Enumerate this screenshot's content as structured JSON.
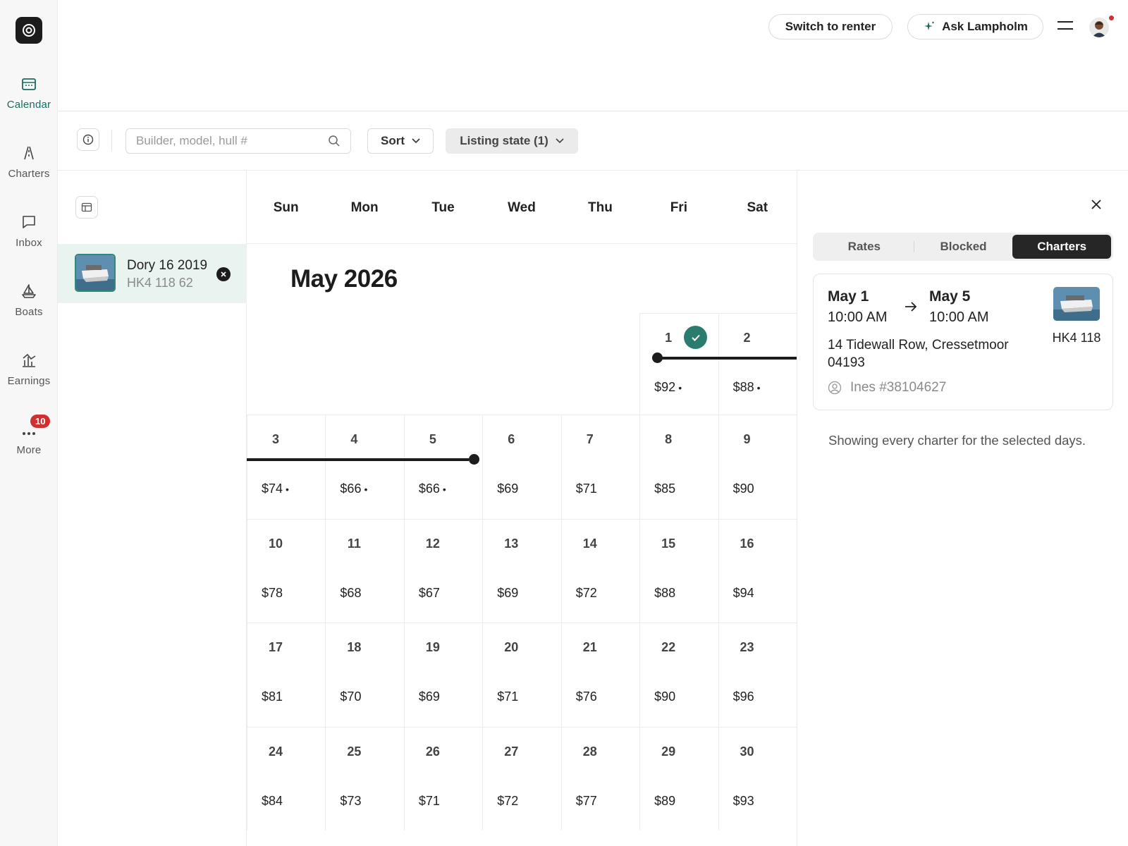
{
  "nav": {
    "items": [
      {
        "label": "Calendar",
        "icon": "calendar-icon",
        "active": true
      },
      {
        "label": "Charters",
        "icon": "route-icon"
      },
      {
        "label": "Inbox",
        "icon": "message-icon"
      },
      {
        "label": "Boats",
        "icon": "sailboat-icon"
      },
      {
        "label": "Earnings",
        "icon": "chart-icon"
      },
      {
        "label": "More",
        "icon": "more-dots-icon",
        "badge": "10"
      }
    ],
    "accent": "#1a6b5e",
    "badge_color": "#d0302f"
  },
  "header": {
    "switch_label": "Switch to renter",
    "ask_label": "Ask Lampholm",
    "ask_icon": "sparkle-icon",
    "menu_icon": "hamburger-icon"
  },
  "toolbar": {
    "search_placeholder": "Builder, model, hull #",
    "search_value": "",
    "sort_label": "Sort",
    "listing_state_label": "Listing state (1)"
  },
  "listing": {
    "name": "Dory 16 2019",
    "hull": "HK4 118 62"
  },
  "calendar": {
    "days_of_week": [
      "Sun",
      "Mon",
      "Tue",
      "Wed",
      "Thu",
      "Fri",
      "Sat"
    ],
    "month_title": "May 2026",
    "first_week": [
      {
        "day": "1",
        "price": "$92",
        "dot": "•",
        "checked": true
      },
      {
        "day": "2",
        "price": "$88",
        "dot": "•"
      }
    ],
    "weeks": [
      [
        {
          "day": "3",
          "price": "$74",
          "dot": "•"
        },
        {
          "day": "4",
          "price": "$66",
          "dot": "•"
        },
        {
          "day": "5",
          "price": "$66",
          "dot": "•"
        },
        {
          "day": "6",
          "price": "$69"
        },
        {
          "day": "7",
          "price": "$71"
        },
        {
          "day": "8",
          "price": "$85"
        },
        {
          "day": "9",
          "price": "$90"
        }
      ],
      [
        {
          "day": "10",
          "price": "$78"
        },
        {
          "day": "11",
          "price": "$68"
        },
        {
          "day": "12",
          "price": "$67"
        },
        {
          "day": "13",
          "price": "$69"
        },
        {
          "day": "14",
          "price": "$72"
        },
        {
          "day": "15",
          "price": "$88"
        },
        {
          "day": "16",
          "price": "$94"
        }
      ],
      [
        {
          "day": "17",
          "price": "$81"
        },
        {
          "day": "18",
          "price": "$70"
        },
        {
          "day": "19",
          "price": "$69"
        },
        {
          "day": "20",
          "price": "$71"
        },
        {
          "day": "21",
          "price": "$76"
        },
        {
          "day": "22",
          "price": "$90"
        },
        {
          "day": "23",
          "price": "$96"
        }
      ],
      [
        {
          "day": "24",
          "price": "$84"
        },
        {
          "day": "25",
          "price": "$73"
        },
        {
          "day": "26",
          "price": "$71"
        },
        {
          "day": "27",
          "price": "$72"
        },
        {
          "day": "28",
          "price": "$77"
        },
        {
          "day": "29",
          "price": "$89"
        },
        {
          "day": "30",
          "price": "$93"
        }
      ]
    ],
    "check_color": "#2a7d6e"
  },
  "panel": {
    "tabs": [
      {
        "label": "Rates"
      },
      {
        "label": "Blocked"
      },
      {
        "label": "Charters",
        "active": true
      }
    ],
    "charter": {
      "start_date": "May 1",
      "start_time": "10:00 AM",
      "end_date": "May 5",
      "end_time": "10:00 AM",
      "hull": "HK4 118",
      "address": "14 Tidewall Row, Cressetmoor 04193",
      "renter": "Ines #38104627"
    },
    "note": "Showing every charter for the selected days."
  }
}
